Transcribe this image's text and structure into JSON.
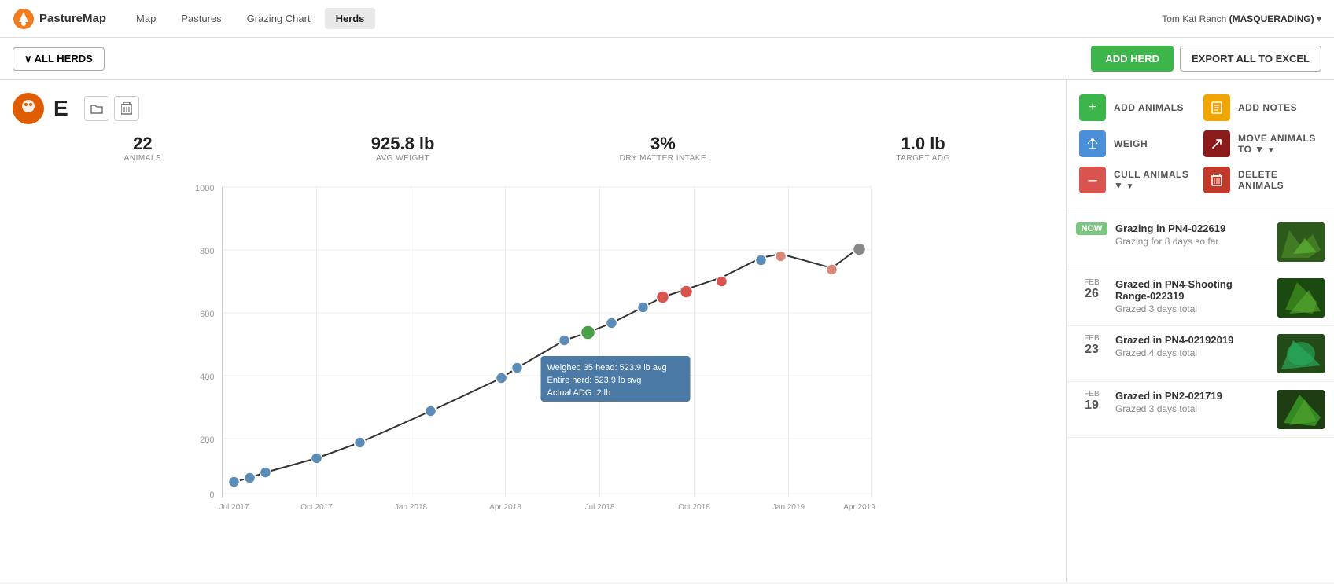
{
  "nav": {
    "logo_text": "PastureMap",
    "links": [
      "Map",
      "Pastures",
      "Grazing Chart",
      "Herds"
    ],
    "active_link": "Herds",
    "user": "Tom Kat Ranch",
    "user_status": "(MASQUERADING)"
  },
  "toolbar": {
    "all_herds_label": "∨ ALL HERDS",
    "add_herd_label": "ADD HERD",
    "export_label": "EXPORT ALL TO EXCEL"
  },
  "herd": {
    "icon_letter": "E",
    "stats": [
      {
        "value": "22",
        "label": "ANIMALS"
      },
      {
        "value": "925.8 lb",
        "label": "AVG WEIGHT"
      },
      {
        "value": "3%",
        "label": "DRY MATTER INTAKE"
      },
      {
        "value": "1.0 lb",
        "label": "TARGET ADG"
      }
    ],
    "tooltip": {
      "line1": "Weighed 35 head: 523.9 lb avg",
      "line2": "Entire herd: 523.9 lb avg",
      "line3": "Actual ADG: 2 lb"
    }
  },
  "chart": {
    "y_labels": [
      "1000",
      "800",
      "600",
      "400",
      "200",
      "0"
    ],
    "x_labels": [
      "Jul 2017",
      "Oct 2017",
      "Jan 2018",
      "Apr 2018",
      "Jul 2018",
      "Oct 2018",
      "Jan 2019",
      "Apr 2019"
    ]
  },
  "actions": [
    {
      "icon": "+",
      "color": "green",
      "label": "ADD ANIMALS"
    },
    {
      "icon": "📋",
      "color": "yellow",
      "label": "ADD NOTES"
    },
    {
      "icon": "⚖",
      "color": "blue",
      "label": "WEIGH"
    },
    {
      "icon": "↗",
      "color": "dark-red",
      "label": "MOVE ANIMALS TO",
      "arrow": true
    },
    {
      "icon": "–",
      "color": "red",
      "label": "CULL ANIMALS",
      "arrow": true
    },
    {
      "icon": "🗑",
      "color": "dark-red2",
      "label": "DELETE ANIMALS"
    }
  ],
  "timeline": [
    {
      "date_label": "NOW",
      "date_num": "",
      "is_now": true,
      "title": "Grazing in PN4-022619",
      "sub": "Grazing for 8 days so far"
    },
    {
      "date_label": "FEB",
      "date_num": "26",
      "title": "Grazed in PN4-Shooting Range-022319",
      "sub": "Grazed 3 days total"
    },
    {
      "date_label": "FEB",
      "date_num": "23",
      "title": "Grazed in PN4-02192019",
      "sub": "Grazed 4 days total"
    },
    {
      "date_label": "FEB",
      "date_num": "19",
      "title": "Grazed in PN2-021719",
      "sub": "Grazed 3 days total"
    }
  ]
}
